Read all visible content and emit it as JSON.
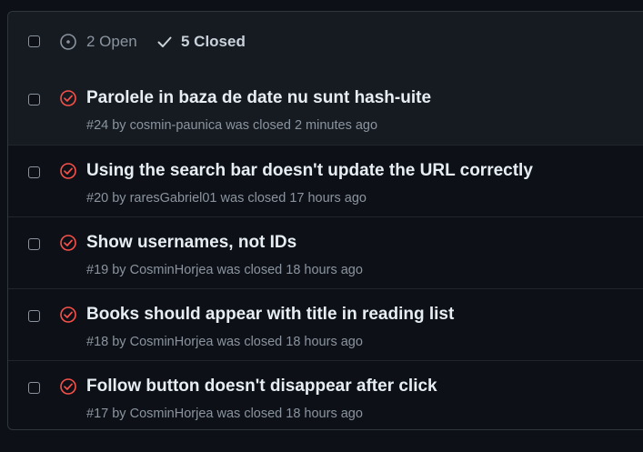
{
  "header": {
    "open_label": "2 Open",
    "closed_label": "5 Closed"
  },
  "issues": [
    {
      "title": "Parolele in baza de date nu sunt hash-uite",
      "number": "#24",
      "by": "by",
      "author": "cosmin-paunica",
      "closed": "was closed",
      "time": "2 minutes ago"
    },
    {
      "title": "Using the search bar doesn't update the URL correctly",
      "number": "#20",
      "by": "by",
      "author": "raresGabriel01",
      "closed": "was closed",
      "time": "17 hours ago"
    },
    {
      "title": "Show usernames, not IDs",
      "number": "#19",
      "by": "by",
      "author": "CosminHorjea",
      "closed": "was closed",
      "time": "18 hours ago"
    },
    {
      "title": "Books should appear with title in reading list",
      "number": "#18",
      "by": "by",
      "author": "CosminHorjea",
      "closed": "was closed",
      "time": "18 hours ago"
    },
    {
      "title": "Follow button doesn't disappear after click",
      "number": "#17",
      "by": "by",
      "author": "CosminHorjea",
      "closed": "was closed",
      "time": "18 hours ago"
    }
  ],
  "colors": {
    "closed_icon": "#f85149",
    "background": "#0d1117",
    "header_bg": "#161b22"
  },
  "icons": {
    "open_state": "issue-opened-icon",
    "closed_state": "check-icon",
    "issue_status": "issue-closed-icon"
  }
}
